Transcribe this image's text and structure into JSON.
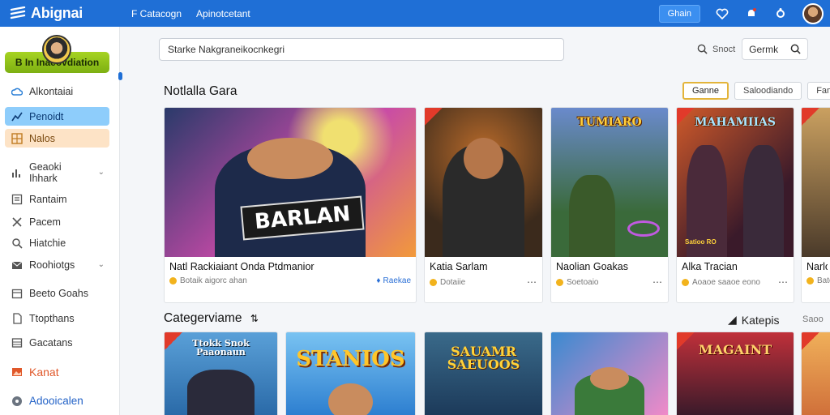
{
  "topbar": {
    "brand": "Abignai",
    "nav": [
      "F Catacogn",
      "Apinotcetant"
    ],
    "signin": "Ghain"
  },
  "sidebar": {
    "user_button": "B In Inaeovdiation",
    "items": [
      {
        "label": "Alkontaiai",
        "icon": "cloud-icon"
      },
      {
        "label": "Penoidt",
        "icon": "chart-icon",
        "state": "active-blue"
      },
      {
        "label": "Nalos",
        "icon": "grid-icon",
        "state": "active-orange"
      },
      {
        "label": "Geaoki Ihhark",
        "icon": "bar-chart-icon",
        "chevron": true
      },
      {
        "label": "Rantaim",
        "icon": "list-icon"
      },
      {
        "label": "Pacem",
        "icon": "tools-icon"
      },
      {
        "label": "Hiatchie",
        "icon": "search-icon"
      },
      {
        "label": "Roohiotgs",
        "icon": "mail-icon",
        "chevron": true
      },
      {
        "label": "Beeto Goahs",
        "icon": "calendar-icon"
      },
      {
        "label": "Ttopthans",
        "icon": "doc-icon"
      },
      {
        "label": "Gacatans",
        "icon": "table-icon"
      },
      {
        "label": "Kanat",
        "icon": "photo-icon",
        "style": "accent"
      },
      {
        "label": "Adooicalen",
        "icon": "help-icon",
        "style": "blue-text"
      }
    ]
  },
  "search": {
    "value": "Starke Nakgraneikocnkegri",
    "right_label": "Snoct",
    "right_box": "Germk"
  },
  "section1": {
    "title": "Notlalla Gara",
    "filters": [
      "Ganne",
      "Saloodiando",
      "Faml"
    ]
  },
  "cards": [
    {
      "title": "Natl Rackiaiant Onda Ptdmanior",
      "meta": "Botaik aigorc ahan",
      "tag": "Raekae",
      "art": "BARLAN",
      "bg": [
        "#2a3a6a",
        "#c84aa8"
      ]
    },
    {
      "title": "Katia Sarlam",
      "meta": "Dotaiie",
      "art": "",
      "bg": [
        "#3b2a1c",
        "#8a5a2a"
      ]
    },
    {
      "title": "Naolian Goakas",
      "meta": "Soetoaio",
      "art": "TUMIARO",
      "bg": [
        "#2a4a2a",
        "#6a8acc"
      ]
    },
    {
      "title": "Alka Tracian",
      "meta": "Aoaoe saaoe eono",
      "subtitle": "Satioo RO",
      "art": "MAHAMIIAS",
      "bg": [
        "#3a1a2a",
        "#d05a2a"
      ]
    },
    {
      "title": "Narlo",
      "meta": "Batoo",
      "art": "",
      "bg": [
        "#4a3a2a",
        "#caa060"
      ]
    }
  ],
  "section2": {
    "title": "Categerviame",
    "right_label": "Katepis",
    "right_extra": "Saoo"
  },
  "cards2": [
    {
      "art": "Ttokk Snok Paaonaun",
      "bg": [
        "#2a6aa8",
        "#5aa0d8"
      ],
      "color": "#ffffff"
    },
    {
      "art": "STANIOS",
      "bg": [
        "#2d7fd0",
        "#79c3f2"
      ],
      "color": "#ffc62a"
    },
    {
      "art": "SAUAMR SAEUOOS",
      "bg": [
        "#1c3a5a",
        "#3a6a8a"
      ],
      "color": "#ffd23a"
    },
    {
      "art": "",
      "bg": [
        "#3a8ad0",
        "#f08ac8"
      ],
      "color": "#ffffff"
    },
    {
      "art": "MAGAINT",
      "bg": [
        "#3a1a2a",
        "#c0303a"
      ],
      "color": "#ffd26a"
    },
    {
      "art": "",
      "bg": [
        "#d0703a",
        "#f0b05a"
      ],
      "color": "#ffffff"
    }
  ],
  "colors": {
    "topbar": "#1f6fd6",
    "accent_green": "#a6d322",
    "active_blue": "#8ecdfb",
    "active_orange": "#fde3c6"
  }
}
